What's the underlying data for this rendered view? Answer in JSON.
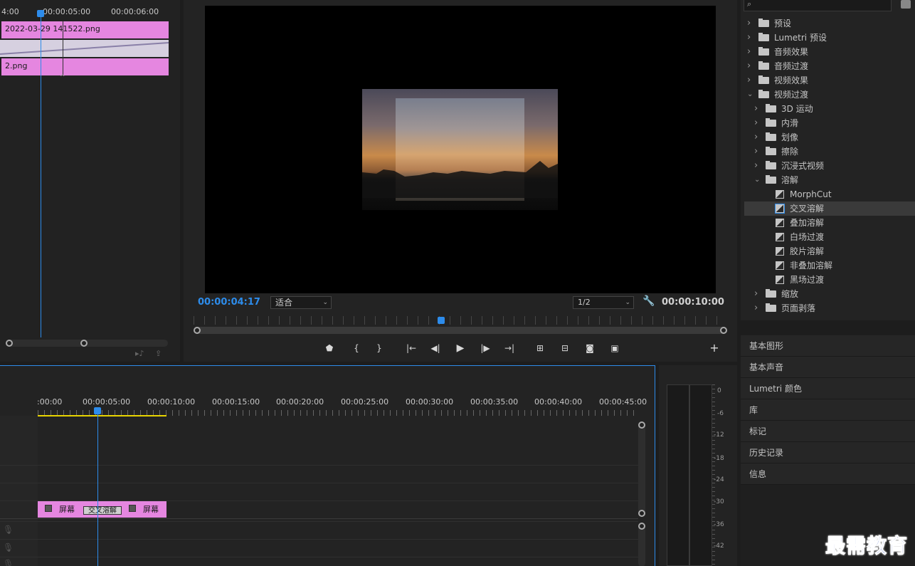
{
  "source_monitor": {
    "ruler": [
      "4:00",
      "00:00:05:00",
      "00:00:06:00"
    ],
    "clip_top_label": "2022-03-29 141522.png",
    "clip_bottom_label": "2.png"
  },
  "program_monitor": {
    "timecode_current": "00:00:04:17",
    "zoom_select": "适合",
    "resolution_select": "1/2",
    "timecode_duration": "00:00:10:00"
  },
  "timeline": {
    "ruler": [
      ":00:00",
      "00:00:05:00",
      "00:00:10:00",
      "00:00:15:00",
      "00:00:20:00",
      "00:00:25:00",
      "00:00:30:00",
      "00:00:35:00",
      "00:00:40:00",
      "00:00:45:00"
    ],
    "clip_a_label": "屏幕",
    "clip_b_label": "屏幕",
    "transition_label": "交叉溶解"
  },
  "audio_meter": {
    "ticks": [
      "0",
      "-6",
      "-12",
      "-18",
      "-24",
      "-30",
      "-36",
      "-42"
    ]
  },
  "effects_tree": [
    {
      "label": "预设",
      "level": 0,
      "type": "folder",
      "open": false
    },
    {
      "label": "Lumetri 预设",
      "level": 0,
      "type": "folder",
      "open": false
    },
    {
      "label": "音频效果",
      "level": 0,
      "type": "folder",
      "open": false
    },
    {
      "label": "音频过渡",
      "level": 0,
      "type": "folder",
      "open": false
    },
    {
      "label": "视频效果",
      "level": 0,
      "type": "folder",
      "open": false
    },
    {
      "label": "视频过渡",
      "level": 0,
      "type": "folder",
      "open": true
    },
    {
      "label": "3D 运动",
      "level": 1,
      "type": "folder",
      "open": false
    },
    {
      "label": "内滑",
      "level": 1,
      "type": "folder",
      "open": false
    },
    {
      "label": "划像",
      "level": 1,
      "type": "folder",
      "open": false
    },
    {
      "label": "擦除",
      "level": 1,
      "type": "folder",
      "open": false
    },
    {
      "label": "沉浸式视频",
      "level": 1,
      "type": "folder",
      "open": false
    },
    {
      "label": "溶解",
      "level": 1,
      "type": "folder",
      "open": true
    },
    {
      "label": "MorphCut",
      "level": 2,
      "type": "effect"
    },
    {
      "label": "交叉溶解",
      "level": 2,
      "type": "effect",
      "selected": true
    },
    {
      "label": "叠加溶解",
      "level": 2,
      "type": "effect"
    },
    {
      "label": "白场过渡",
      "level": 2,
      "type": "effect"
    },
    {
      "label": "胶片溶解",
      "level": 2,
      "type": "effect"
    },
    {
      "label": "非叠加溶解",
      "level": 2,
      "type": "effect"
    },
    {
      "label": "黑场过渡",
      "level": 2,
      "type": "effect"
    },
    {
      "label": "缩放",
      "level": 1,
      "type": "folder",
      "open": false
    },
    {
      "label": "页面剥落",
      "level": 1,
      "type": "folder",
      "open": false
    }
  ],
  "side_panels": [
    "基本图形",
    "基本声音",
    "Lumetri 颜色",
    "库",
    "标记",
    "历史记录",
    "信息"
  ],
  "watermark": "最需教育",
  "colors": {
    "accent": "#2d8ceb",
    "clip": "#e586e0",
    "selected_row": "#3a3a3a",
    "in_out_bar": "#e8d400"
  }
}
